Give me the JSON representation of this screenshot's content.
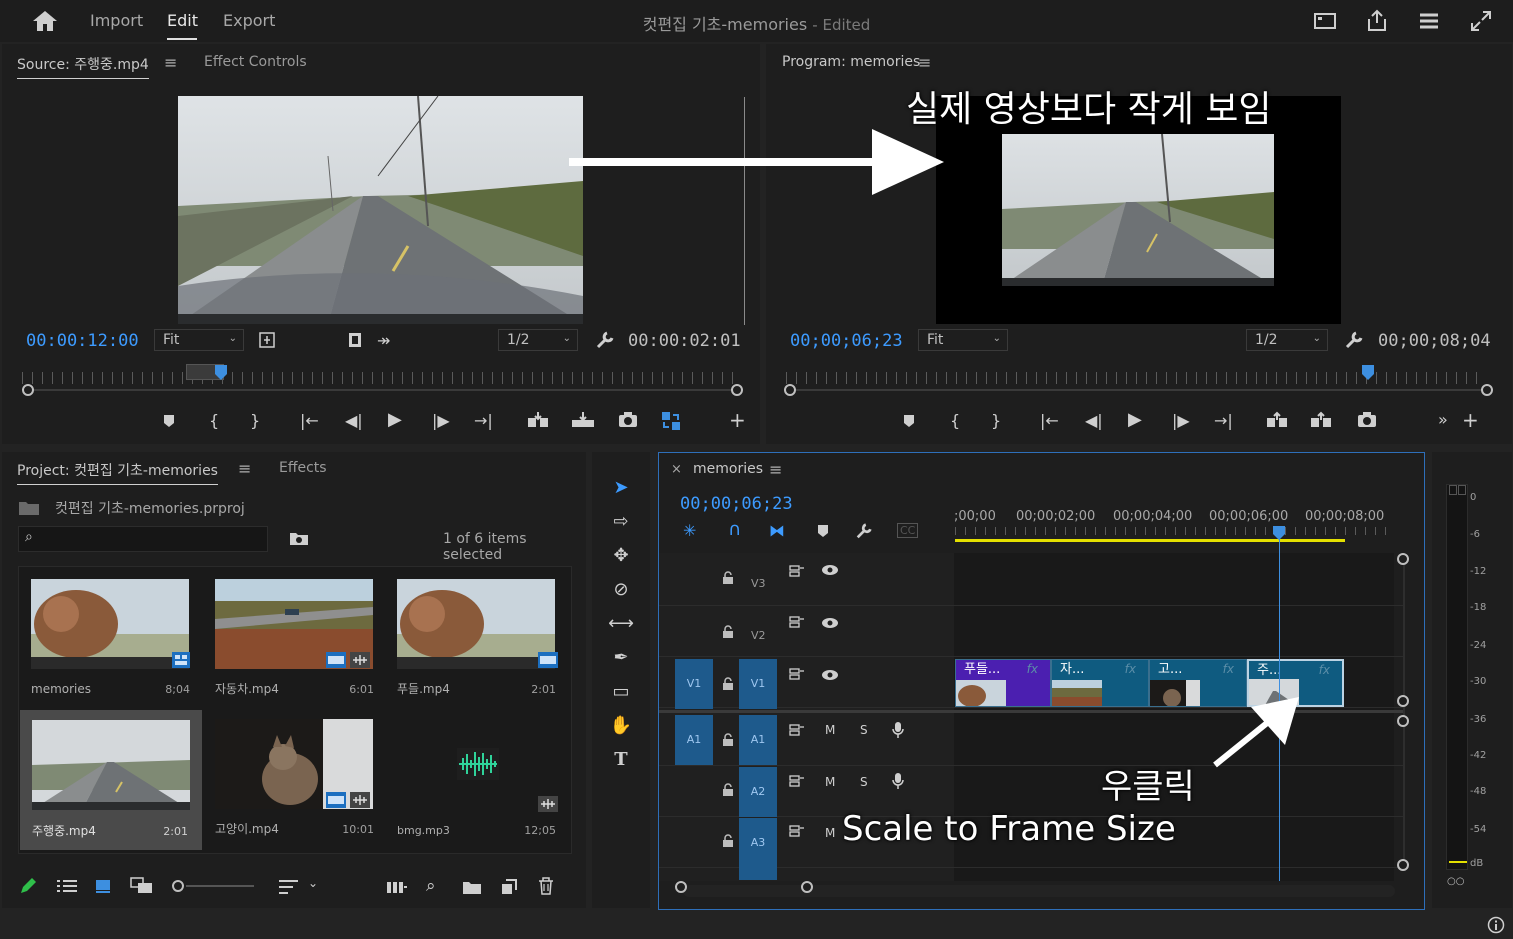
{
  "app": {
    "nav": {
      "import": "Import",
      "edit": "Edit",
      "export": "Export"
    },
    "title": "컷편집 기초-memories",
    "title_status": "- Edited"
  },
  "source_panel": {
    "tab_source": "Source: 주행중.mp4",
    "tab_effects": "Effect Controls",
    "timecode_in": "00:00:12:00",
    "zoom": "Fit",
    "resolution": "1/2",
    "timecode_dur": "00:00:02:01"
  },
  "program_panel": {
    "tab": "Program: memories",
    "timecode_in": "00;00;06;23",
    "zoom": "Fit",
    "resolution": "1/2",
    "timecode_dur": "00;00;08;04",
    "overlay_caption": "실제 영상보다 작게 보임"
  },
  "project_panel": {
    "tab_project": "Project: 컷편집 기초-memories",
    "tab_effects": "Effects",
    "file": "컷편집 기초-memories.prproj",
    "search_placeholder": "",
    "selection": "1 of 6 items selected",
    "items": [
      {
        "name": "memories",
        "duration": "8;04",
        "icon": "sequence-icon",
        "selected": false
      },
      {
        "name": "자동차.mp4",
        "duration": "6:01",
        "icon": "video-audio-icon",
        "selected": false
      },
      {
        "name": "푸들.mp4",
        "duration": "2:01",
        "icon": "video-icon",
        "selected": false
      },
      {
        "name": "주행중.mp4",
        "duration": "2:01",
        "icon": "",
        "selected": true
      },
      {
        "name": "고양이.mp4",
        "duration": "10:01",
        "icon": "video-audio-icon",
        "selected": false
      },
      {
        "name": "bmg.mp3",
        "duration": "12;05",
        "icon": "audio-icon",
        "selected": false
      }
    ]
  },
  "timeline_panel": {
    "tab": "memories",
    "timecode": "00;00;06;23",
    "ruler_labels": [
      ";00;00",
      "00;00;02;00",
      "00;00;04;00",
      "00;00;06;00",
      "00;00;08;00"
    ],
    "tracks": {
      "v3": "V3",
      "v2": "V2",
      "v1": "V1",
      "v1_src": "V1",
      "a1": "A1",
      "a1_src": "A1",
      "a2": "A2",
      "a3": "A3",
      "mute": "M",
      "solo": "S"
    },
    "clips": [
      {
        "label": "푸들...",
        "fx": "fx",
        "color": "#4b1fb0"
      },
      {
        "label": "자...",
        "fx": "fx",
        "color": "#0f5b80"
      },
      {
        "label": "고...",
        "fx": "fx",
        "color": "#0f5b80"
      },
      {
        "label": "주...",
        "fx": "fx",
        "color": "#0f5b80"
      }
    ],
    "annotation_rightclick": "우클릭",
    "annotation_scale": "Scale to Frame Size"
  },
  "audio_meter": {
    "ticks": [
      "0",
      "-6",
      "-12",
      "-18",
      "-24",
      "-30",
      "-36",
      "-42",
      "-48",
      "-54",
      "dB"
    ],
    "solo_buttons": "○○"
  },
  "colors": {
    "accent_blue": "#3d9bff",
    "playhead": "#3d8fe0",
    "work_area": "#e4e000"
  }
}
